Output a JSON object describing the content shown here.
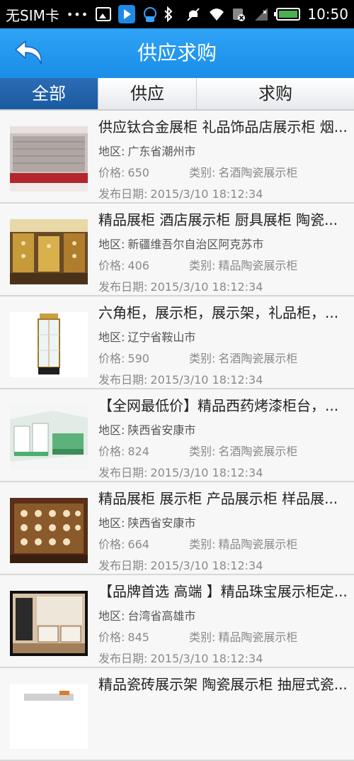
{
  "status_bar": {
    "carrier": "无SIM卡",
    "dots": "•••",
    "time": "10:50"
  },
  "header": {
    "title": "供应求购",
    "back_icon": "back-arrow-icon",
    "bg_color": "#2196f3"
  },
  "tabs": [
    {
      "label": "全部",
      "active": true
    },
    {
      "label": "供应",
      "active": false
    },
    {
      "label": "求购",
      "active": false
    }
  ],
  "labels": {
    "region": "地区:",
    "price": "价格:",
    "category": "类别:",
    "date": "发布日期:"
  },
  "items": [
    {
      "title": "供应钛合金展柜 礼品饰品店展示柜 烟...",
      "region": "广东省潮州市",
      "price": "650",
      "category": "名酒陶瓷展示柜",
      "date": "2015/3/10 18:12:34"
    },
    {
      "title": "精品展柜 酒店展示柜 厨具展柜 陶瓷...",
      "region": "新疆维吾尔自治区阿克苏市",
      "price": "406",
      "category": "精品陶瓷展示柜",
      "date": "2015/3/10 18:12:34"
    },
    {
      "title": "六角柜，展示柜，展示架，礼品柜，...",
      "region": "辽宁省鞍山市",
      "price": "590",
      "category": "名酒陶瓷展示柜",
      "date": "2015/3/10 18:12:34"
    },
    {
      "title": "【全网最低价】精品西药烤漆柜台，...",
      "region": "陕西省安康市",
      "price": "824",
      "category": "名酒陶瓷展示柜",
      "date": "2015/3/10 18:12:34"
    },
    {
      "title": "精品展柜 展示柜 产品展示柜 样品展...",
      "region": "陕西省安康市",
      "price": "664",
      "category": "精品陶瓷展示柜",
      "date": "2015/3/10 18:12:34"
    },
    {
      "title": "【品牌首选 高端 】精品珠宝展示柜定...",
      "region": "台湾省高雄市",
      "price": "845",
      "category": "精品陶瓷展示柜",
      "date": "2015/3/10 18:12:34"
    },
    {
      "title": "精品瓷砖展示架 陶瓷展示柜 抽屉式瓷...",
      "region": "",
      "price": "",
      "category": "",
      "date": ""
    }
  ]
}
